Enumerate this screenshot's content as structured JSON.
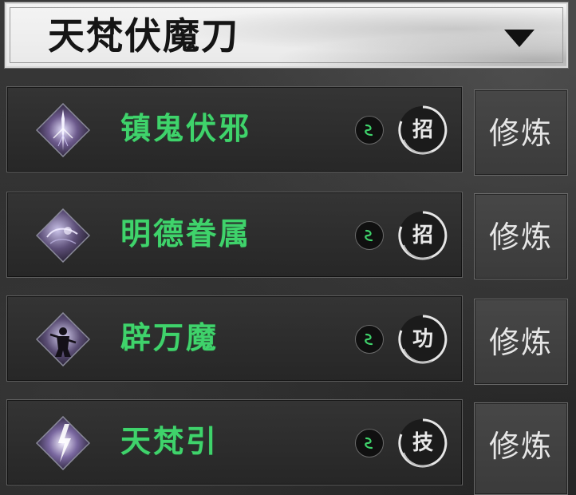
{
  "header": {
    "title": "天梵伏魔刀",
    "dropdown_icon": "chevron-down-icon"
  },
  "skills": [
    {
      "name": "镇鬼伏邪",
      "type": "招",
      "action": "修炼",
      "icon": "sword-skill-icon"
    },
    {
      "name": "明德眷属",
      "type": "招",
      "action": "修炼",
      "icon": "mist-skill-icon"
    },
    {
      "name": "辟万魔",
      "type": "功",
      "action": "修炼",
      "icon": "warrior-skill-icon"
    },
    {
      "name": "天梵引",
      "type": "技",
      "action": "修炼",
      "icon": "lightning-skill-icon"
    }
  ],
  "colors": {
    "skill_name": "#3fd36b",
    "rune_glow": "#3fd36b",
    "badge_ring": "#e6e6e6"
  }
}
